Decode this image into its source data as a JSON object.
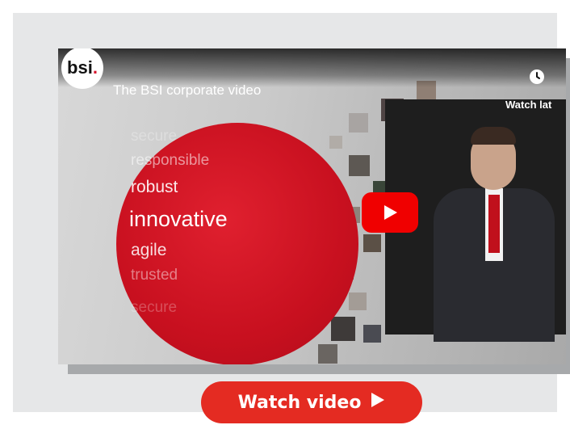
{
  "video": {
    "brand": "bsi",
    "title": "The BSI corporate video",
    "watch_later": "Watch lat",
    "words": [
      "secure",
      "responsible",
      "robust",
      "innovative",
      "agile",
      "trusted",
      "secure"
    ],
    "icons": {
      "clock": "clock-icon",
      "play": "play-icon"
    }
  },
  "cta": {
    "label": "Watch video",
    "icon": "play-triangle-icon"
  },
  "colors": {
    "brand_red": "#e42b22",
    "youtube_red": "#f00000",
    "card_bg": "#e6e7e8"
  }
}
